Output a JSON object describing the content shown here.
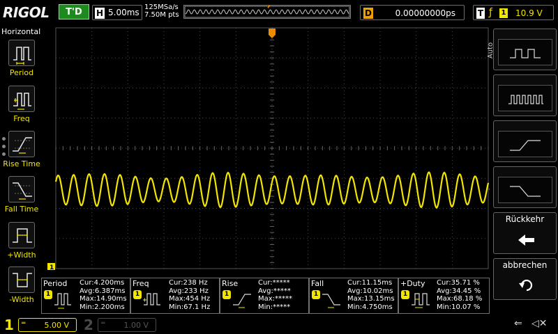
{
  "top_bar": {
    "logo": "RIGOL",
    "run_status": "T'D",
    "horizontal_label": "H",
    "time_scale": "5.00ms",
    "sample_rate": "125MSa/s",
    "memory_depth": "7.50M pts",
    "delay_label": "D",
    "trigger_delay": "0.00000000ps",
    "trigger_label": "T",
    "trigger_edge_symbol": "ƒ",
    "trigger_source": "1",
    "trigger_level": "10.9 V"
  },
  "left_menu": {
    "title": "Horizontal",
    "items": [
      {
        "label": "Period",
        "icon": "period-icon"
      },
      {
        "label": "Freq",
        "icon": "frequency-icon"
      },
      {
        "label": "Rise Time",
        "icon": "rise-time-icon"
      },
      {
        "label": "Fall Time",
        "icon": "fall-time-icon"
      },
      {
        "label": "+Width",
        "icon": "positive-width-icon"
      },
      {
        "label": "-Width",
        "icon": "negative-width-icon"
      }
    ]
  },
  "right_menu": {
    "mode_label": "Auto",
    "back_label": "Rückkehr",
    "cancel_label": "abbrechen",
    "buttons": [
      {
        "icon": "square-wave-slow-icon"
      },
      {
        "icon": "square-wave-fast-icon"
      },
      {
        "icon": "rising-edge-icon"
      },
      {
        "icon": "falling-edge-icon"
      }
    ]
  },
  "waveform": {
    "channel": "1",
    "color": "#f2e600",
    "ground_marker": "1",
    "cycles_on_screen": 28
  },
  "measurements": [
    {
      "name": "Period",
      "source": "1",
      "cur": "Cur:4.200ms",
      "avg": "Avg:6.387ms",
      "max": "Max:14.90ms",
      "min": "Min:2.200ms"
    },
    {
      "name": "Freq",
      "source": "1",
      "cur": "Cur:238 Hz",
      "avg": "Avg:233 Hz",
      "max": "Max:454 Hz",
      "min": "Min:67.1 Hz"
    },
    {
      "name": "Rise",
      "source": "1",
      "cur": "Cur:*****",
      "avg": "Avg:*****",
      "max": "Max:*****",
      "min": "Min:*****"
    },
    {
      "name": "Fall",
      "source": "1",
      "cur": "Cur:11.15ms",
      "avg": "Avg:10.02ms",
      "max": "Max:13.15ms",
      "min": "Min:4.750ms"
    },
    {
      "name": "+Duty",
      "source": "1",
      "cur": "Cur:35.71 %",
      "avg": "Avg:34.45 %",
      "max": "Max:68.18 %",
      "min": "Min:10.07 %"
    }
  ],
  "bottom_bar": {
    "ch1": {
      "number": "1",
      "coupling": "═",
      "scale": "5.00 V",
      "color": "#f2e600"
    },
    "ch2": {
      "number": "2",
      "coupling": "═",
      "scale": "1.00 V",
      "color": "#4a4a4a"
    }
  },
  "colors": {
    "channel1": "#f2e600",
    "trigger_marker": "#f08c00",
    "status_green": "#1d8a1d",
    "grid": "#555555"
  }
}
